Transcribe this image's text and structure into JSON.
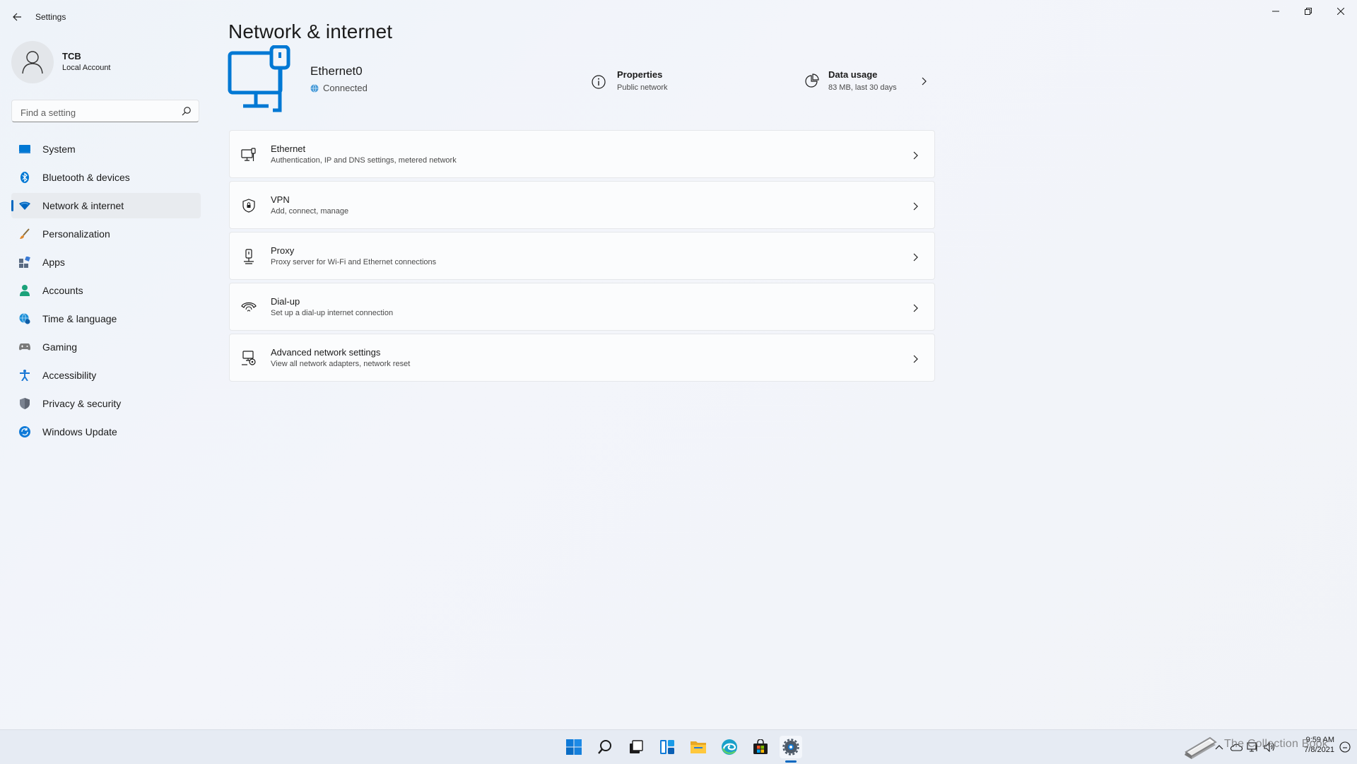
{
  "window": {
    "app_title": "Settings",
    "controls": [
      "minimize-icon",
      "restore-icon",
      "close-icon"
    ]
  },
  "profile": {
    "name": "TCB",
    "account_type": "Local Account"
  },
  "search": {
    "placeholder": "Find a setting",
    "value": ""
  },
  "sidebar": {
    "items": [
      {
        "label": "System",
        "icon": "system-display-icon",
        "color": "#0078d4"
      },
      {
        "label": "Bluetooth & devices",
        "icon": "bluetooth-icon",
        "color": "#0078d4"
      },
      {
        "label": "Network & internet",
        "icon": "wifi-diamond-icon",
        "color": "#0067c0",
        "active": true
      },
      {
        "label": "Personalization",
        "icon": "brush-icon",
        "color": "#e08a2e"
      },
      {
        "label": "Apps",
        "icon": "apps-icon",
        "color": "#5a6b82"
      },
      {
        "label": "Accounts",
        "icon": "person-icon",
        "color": "#1ba27a"
      },
      {
        "label": "Time & language",
        "icon": "globe-clock-icon",
        "color": "#1b8fd8"
      },
      {
        "label": "Gaming",
        "icon": "controller-icon",
        "color": "#7a7a7a"
      },
      {
        "label": "Accessibility",
        "icon": "accessibility-icon",
        "color": "#1b78d4"
      },
      {
        "label": "Privacy & security",
        "icon": "shield-icon",
        "color": "#7a8290"
      },
      {
        "label": "Windows Update",
        "icon": "update-icon",
        "color": "#0f7ad8"
      }
    ]
  },
  "main": {
    "title": "Network & internet",
    "connection": {
      "name": "Ethernet0",
      "status": "Connected"
    },
    "properties": {
      "title": "Properties",
      "subtitle": "Public network"
    },
    "data_usage": {
      "title": "Data usage",
      "subtitle": "83 MB, last 30 days"
    },
    "cards": [
      {
        "title": "Ethernet",
        "subtitle": "Authentication, IP and DNS settings, metered network",
        "icon": "ethernet-icon"
      },
      {
        "title": "VPN",
        "subtitle": "Add, connect, manage",
        "icon": "vpn-shield-icon"
      },
      {
        "title": "Proxy",
        "subtitle": "Proxy server for Wi-Fi and Ethernet connections",
        "icon": "proxy-icon"
      },
      {
        "title": "Dial-up",
        "subtitle": "Set up a dial-up internet connection",
        "icon": "dialup-icon"
      },
      {
        "title": "Advanced network settings",
        "subtitle": "View all network adapters, network reset",
        "icon": "advanced-network-icon"
      }
    ]
  },
  "taskbar": {
    "apps": [
      "start-icon",
      "search-icon",
      "task-view-icon",
      "widgets-icon",
      "file-explorer-icon",
      "edge-icon",
      "store-icon",
      "settings-icon"
    ],
    "active_app": "settings-icon",
    "clock": {
      "time": "9:59 AM",
      "date": "7/8/2021"
    },
    "watermark": "The Collection Book"
  },
  "colors": {
    "accent": "#0067c0",
    "connected_globe": "#4a9bd8"
  }
}
